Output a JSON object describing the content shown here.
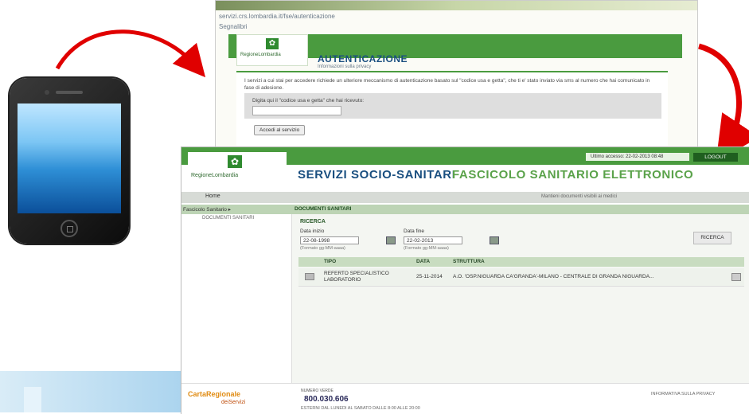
{
  "login": {
    "address_bar": "servizi.crs.lombardia.it/fse/autenticazione",
    "favorites": "Segnalibri",
    "logo_name": "RegioneLombardia",
    "title": "AUTENTICAZIONE",
    "subtitle": "Informazioni sulla privacy",
    "info_text": "I servizi a cui stai per accedere richiede un ulteriore meccanismo di autenticazione basato sul \"codice usa e getta\", che ti e' stato inviato via sms al numero che hai comunicato in fase di adesione.",
    "field_label": "Digita qui il \"codice usa e getta\" che hai ricevuto:",
    "submit_label": "Accedi al servizio"
  },
  "fse": {
    "logo_name": "RegioneLombardia",
    "date_label": "Ultimo accesso: 22-02-2013 08:48",
    "logout_label": "LOGOUT",
    "title_part1": "SERVIZI SOCIO-SANITARI",
    "title_part2": "FASCICOLO SANITARIO ELETTRONICO",
    "nav_home": "Home",
    "nav_option": "Mantieni documenti visibili ai medici",
    "subnav_left": "Fascicolo Sanitario ▸",
    "subnav_right": "DOCUMENTI SANITARI",
    "sidebar_item": "DOCUMENTI SANITARI",
    "search": {
      "section": "RICERCA",
      "from_label": "Data inizio",
      "from_value": "22-08-1998",
      "from_hint": "(Formato gg-MM-aaaa)",
      "to_label": "Data fine",
      "to_value": "22-02-2013",
      "to_hint": "(Formato gg-MM-aaaa)",
      "button": "RICERCA"
    },
    "table": {
      "headers": [
        "TIPO",
        "DATA",
        "STRUTTURA"
      ],
      "rows": [
        {
          "tipo": "REFERTO SPECIALISTICO LABORATORIO",
          "data": "25-11-2014",
          "struttura": "A.O. 'OSP.NIGUARDA CA'GRANDA'-MILANO - CENTRALE DI GRANDA NIGUARDA..."
        }
      ]
    },
    "footer": {
      "crs_line1": "CartaRegionale",
      "crs_line2": "deiServizi",
      "numero_label": "NUMERO VERDE",
      "numero_value": "800.030.606",
      "footer_note": "ESTERNI DAL LUNEDI AL SABATO DALLE 8:00 ALLE 20:00",
      "right_note": "INFORMATIVA SULLA PRIVACY"
    }
  },
  "colors": {
    "brand_green": "#4a9b3f",
    "title_blue": "#1a4f80",
    "arrow_red": "#e00000"
  }
}
